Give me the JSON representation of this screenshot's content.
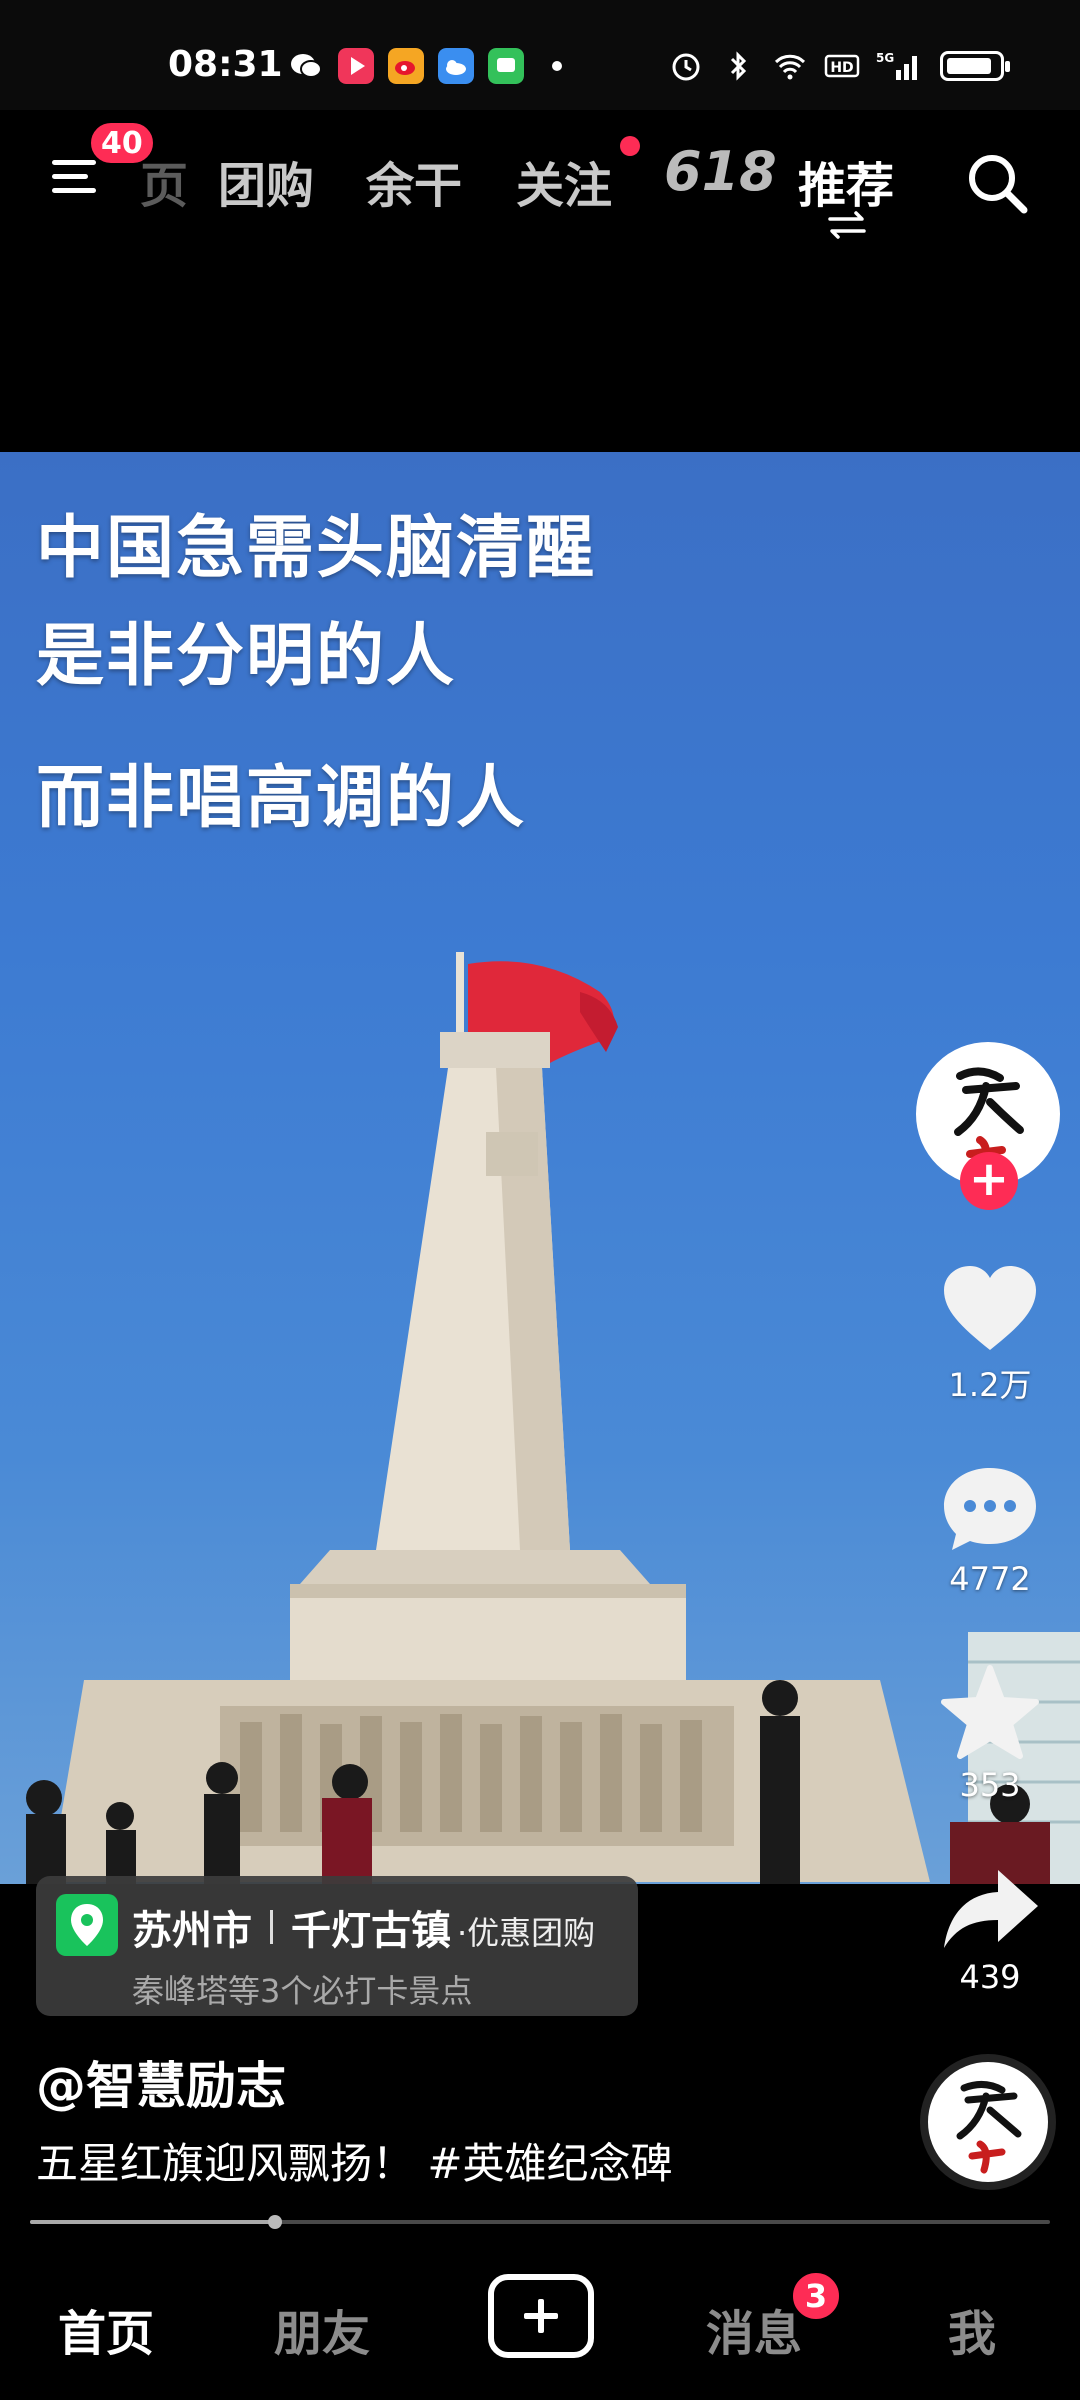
{
  "status_bar": {
    "time": "08:31"
  },
  "top_nav": {
    "menu_badge": "40",
    "tabs": [
      {
        "label": "团购"
      },
      {
        "label": "余干"
      },
      {
        "label": "关注"
      },
      {
        "label": "618"
      },
      {
        "label": "推荐"
      }
    ],
    "partial_tab": "页"
  },
  "video": {
    "caption_lines": [
      "中国急需头脑清醒",
      "是非分明的人",
      "而非唱高调的人"
    ]
  },
  "rail": {
    "likes": "1.2万",
    "comments": "4772",
    "favorites": "353",
    "shares": "439"
  },
  "location": {
    "city": "苏州市",
    "spot": "千灯古镇",
    "deal": "·优惠团购",
    "subtitle": "秦峰塔等3个必打卡景点"
  },
  "post": {
    "author": "@智慧励志",
    "description": "五星红旗迎风飘扬！ #英雄纪念碑"
  },
  "progress": {
    "fraction": 0.24
  },
  "bottom_nav": {
    "home": "首页",
    "friends": "朋友",
    "messages": "消息",
    "messages_badge": "3",
    "me": "我"
  },
  "colors": {
    "accent": "#fe2c55",
    "location_green": "#19c35c"
  }
}
